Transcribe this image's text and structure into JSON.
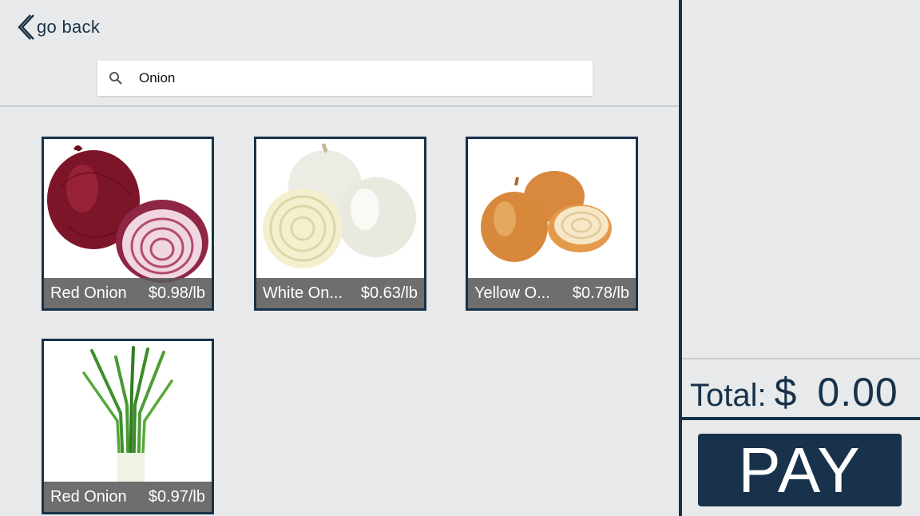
{
  "nav": {
    "back_label": "go back"
  },
  "search": {
    "query": "Onion",
    "icon": "search-icon"
  },
  "products": [
    {
      "name": "Red Onion",
      "price": "$0.98/lb"
    },
    {
      "name": "White On...",
      "price": "$0.63/lb"
    },
    {
      "name": "Yellow O...",
      "price": "$0.78/lb"
    },
    {
      "name": "Red Onion",
      "price": "$0.97/lb"
    }
  ],
  "cart": {
    "total_label": "Total:",
    "currency": "$",
    "total_value": "0.00",
    "pay_label": "PAY"
  },
  "colors": {
    "accent": "#17324a",
    "background": "#e7e9ea",
    "caption": "#5a5a5a"
  }
}
